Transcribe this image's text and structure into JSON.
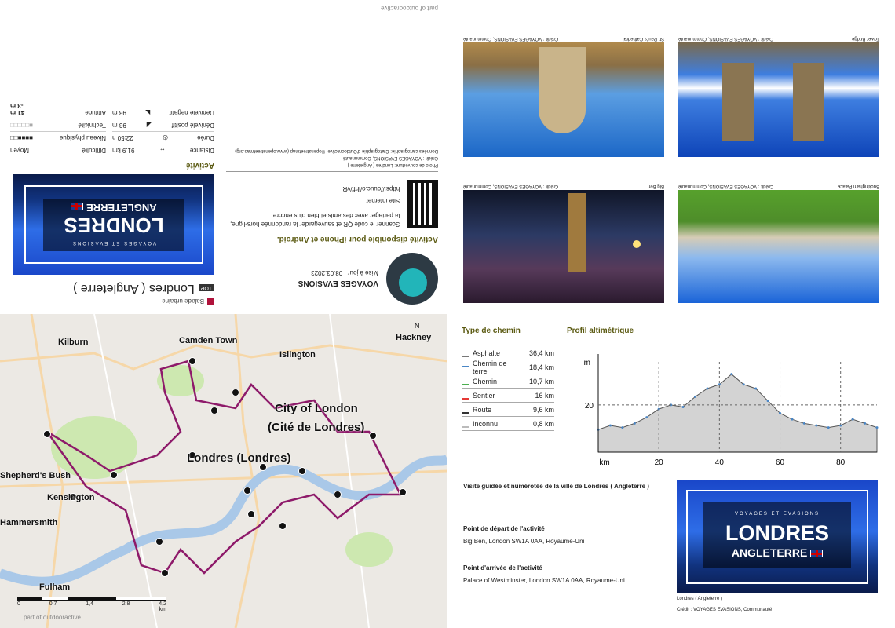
{
  "brochure": {
    "tl": {
      "part_of": "part of outdooractive",
      "category": "Balade urbaine",
      "top_badge": "TOP",
      "title": "Londres ( Angleterre )",
      "cover_city": "LONDRES",
      "cover_country": "ANGLETERRE",
      "cover_brand": "VOYAGES ET EVASIONS",
      "activity_heading": "Activité",
      "stats": [
        {
          "label": "Distance",
          "value": "91,9",
          "unit": "km",
          "icon": "arrows-icon"
        },
        {
          "label": "Durée",
          "value": "22:50",
          "unit": "h",
          "icon": "clock-icon"
        },
        {
          "label": "Dénivelé positif",
          "value": "93",
          "unit": "m",
          "icon": "up-slope-icon"
        },
        {
          "label": "Dénivelé négatif",
          "value": "93",
          "unit": "m",
          "icon": "down-slope-icon"
        }
      ],
      "ratings": [
        {
          "label": "Difficulté",
          "value": "Moyen"
        },
        {
          "label": "Niveau physique",
          "filled": 4,
          "total": 6
        },
        {
          "label": "Technicité",
          "filled": 1,
          "total": 6
        },
        {
          "label": "Altitude",
          "max": "41 m",
          "min": "-3 m"
        }
      ],
      "org_name": "VOYAGES EVASIONS",
      "updated": "Mise à jour : 08.03.2023",
      "app_heading": "Activité disponible pour iPhone et Android.",
      "app_text": "Scanner le code QR et sauvegarder la randonnée hors-ligne, la partager avec des amis et bien plus encore ...",
      "website_label": "Site internet",
      "website_url": "https://ouuc.o/ihff/vR",
      "photo_credit": "Photo de couverture: Londres ( Angleterre )",
      "photo_credit2": "Crédit : VOYAGES EVASIONS, Communauté",
      "carto": "Données cartographie: Cartographie d'Outdooractive; ©openstreetmap (www.openstreetmap.org)"
    },
    "tr": {
      "photos": [
        {
          "caption": "St. Paul's Cathedral",
          "credit": "Crédit : VOYAGES EVASIONS, Communauté"
        },
        {
          "caption": "Tower Bridge",
          "credit": "Crédit : VOYAGES EVASIONS, Communauté"
        },
        {
          "caption": "Big Ben",
          "credit": "Crédit : VOYAGES EVASIONS, Communauté"
        },
        {
          "caption": "Buckingham Palace",
          "credit": "Crédit : VOYAGES EVASIONS, Communauté"
        }
      ]
    },
    "map": {
      "labels": [
        "Kilburn",
        "Camden Town",
        "Islington",
        "Hackney",
        "City of London",
        "(Cité de Londres)",
        "Londres (Londres)",
        "Shepherd's Bush",
        "Kensington",
        "Hammersmith",
        "Fulham"
      ],
      "scale": [
        "0",
        "0,7",
        "1,4",
        "2,8",
        "4,2"
      ],
      "scale_unit": "km",
      "north": "N",
      "footer": "part of outdooractive"
    },
    "br": {
      "path_heading": "Type de chemin",
      "paths": [
        {
          "label": "Asphalte",
          "value": "36,4 km",
          "color": "#777777"
        },
        {
          "label": "Chemin de terre",
          "value": "18,4 km",
          "color": "#4a86c5"
        },
        {
          "label": "Chemin",
          "value": "10,7 km",
          "color": "#4caf50"
        },
        {
          "label": "Sentier",
          "value": "16 km",
          "color": "#e53935"
        },
        {
          "label": "Route",
          "value": "9,6 km",
          "color": "#333333"
        },
        {
          "label": "Inconnu",
          "value": "0,8 km",
          "color": "#bbbbbb"
        }
      ],
      "profile_heading": "Profil altimétrique",
      "profile_y_unit": "m",
      "profile_x_unit": "km",
      "description": "Visite guidée et numérotée de la ville de Londres ( Angleterre )",
      "start_heading": "Point de départ de l'activité",
      "start_text": "Big Ben, London SW1A 0AA, Royaume-Uni",
      "end_heading": "Point d'arrivée de l'activité",
      "end_text": "Palace of Westminster, London SW1A 0AA, Royaume-Uni",
      "cover_city": "LONDRES",
      "cover_country": "ANGLETERRE",
      "cover_brand": "VOYAGES ET EVASIONS",
      "cover_caption": "Londres ( Angleterre )",
      "cover_credit": "Crédit : VOYAGES EVASIONS, Communauté"
    }
  },
  "chart_data": {
    "type": "area",
    "title": "Profil altimétrique",
    "xlabel": "km",
    "ylabel": "m",
    "xlim": [
      0,
      92
    ],
    "ylim": [
      -3,
      41
    ],
    "x_ticks": [
      20,
      40,
      60,
      80
    ],
    "y_ticks": [
      20
    ],
    "x": [
      0,
      4,
      8,
      12,
      16,
      20,
      24,
      28,
      32,
      36,
      40,
      44,
      48,
      52,
      56,
      60,
      64,
      68,
      72,
      76,
      80,
      84,
      88,
      92
    ],
    "values": [
      8,
      10,
      9,
      11,
      14,
      18,
      20,
      19,
      24,
      28,
      30,
      35,
      30,
      28,
      22,
      16,
      13,
      11,
      10,
      9,
      10,
      13,
      11,
      9
    ]
  }
}
